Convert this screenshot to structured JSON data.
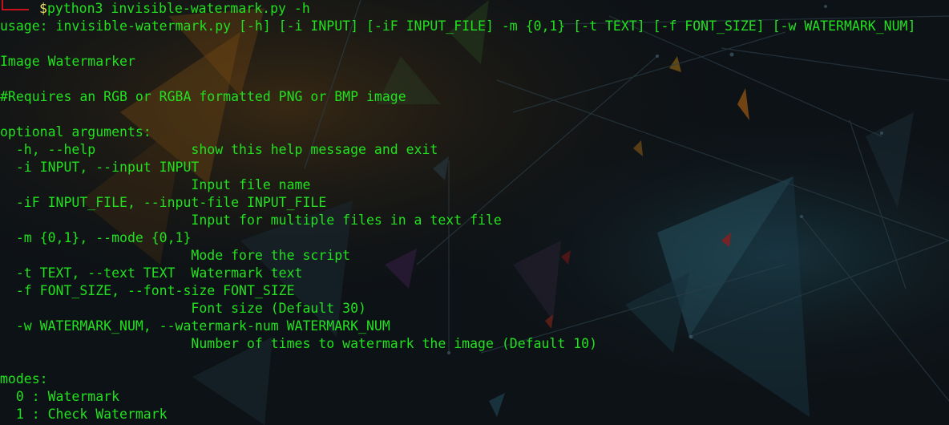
{
  "terminal": {
    "prompt_symbol": "$",
    "command": "python3 invisible-watermark.py -h",
    "lines": [
      "usage: invisible-watermark.py [-h] [-i INPUT] [-iF INPUT_FILE] -m {0,1} [-t TEXT] [-f FONT_SIZE] [-w WATERMARK_NUM]",
      "",
      "Image Watermarker",
      "",
      "#Requires an RGB or RGBA formatted PNG or BMP image",
      "",
      "optional arguments:",
      "  -h, --help            show this help message and exit",
      "  -i INPUT, --input INPUT",
      "                        Input file name",
      "  -iF INPUT_FILE, --input-file INPUT_FILE",
      "                        Input for multiple files in a text file",
      "  -m {0,1}, --mode {0,1}",
      "                        Mode fore the script",
      "  -t TEXT, --text TEXT  Watermark text",
      "  -f FONT_SIZE, --font-size FONT_SIZE",
      "                        Font size (Default 30)",
      "  -w WATERMARK_NUM, --watermark-num WATERMARK_NUM",
      "                        Number of times to watermark the image (Default 10)",
      "",
      "",
      "modes:",
      "  0 : Watermark",
      "  1 : Check Watermark"
    ]
  },
  "colors": {
    "text": "#22e11f",
    "prompt_corner": "#c8121b",
    "prompt_dollar": "#e8e066",
    "background": "#0d1216"
  }
}
